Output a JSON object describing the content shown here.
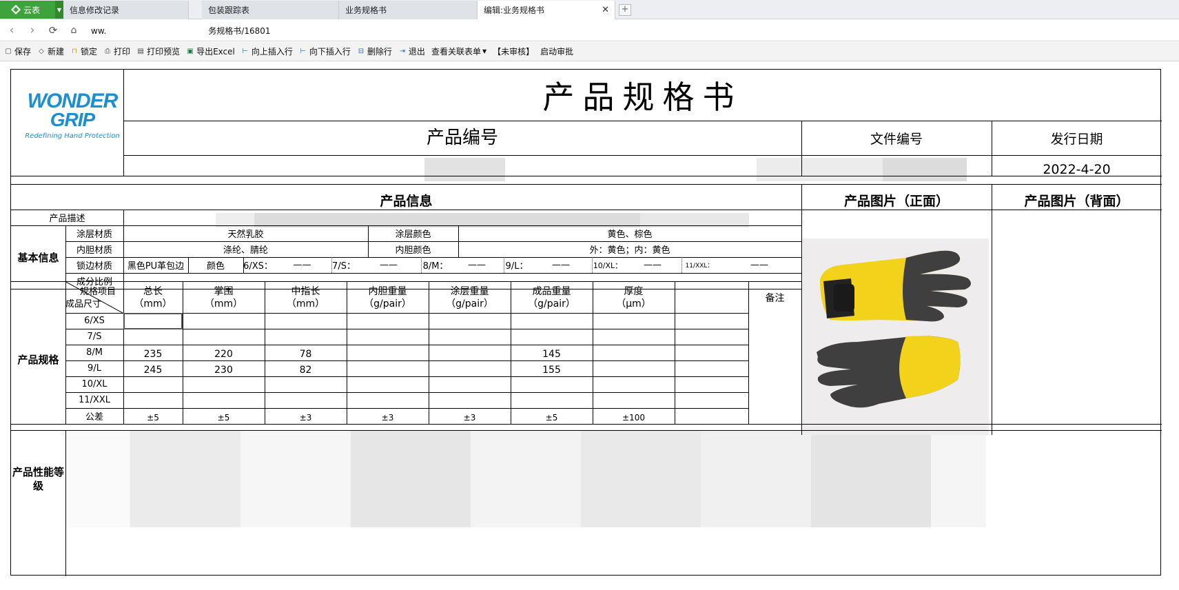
{
  "tabs": {
    "app_label": "云表",
    "items": [
      {
        "label": "信息修改记录"
      },
      {
        "label": "包装跟踪表"
      },
      {
        "label": "业务规格书"
      },
      {
        "label": "编辑:业务规格书"
      }
    ],
    "close_icon": "close-icon",
    "new_tab_icon": "new-tab-icon"
  },
  "address": {
    "prefix": "ww.",
    "suffix": "务规格书/16801"
  },
  "toolbar": [
    {
      "label": "保存",
      "icon": "save-icon"
    },
    {
      "label": "新建",
      "icon": "new-icon"
    },
    {
      "label": "锁定",
      "icon": "lock-icon"
    },
    {
      "label": "打印",
      "icon": "print-icon"
    },
    {
      "label": "打印预览",
      "icon": "print-preview-icon"
    },
    {
      "label": "导出Excel",
      "icon": "excel-icon"
    },
    {
      "label": "向上插入行",
      "icon": "insert-above-icon"
    },
    {
      "label": "向下插入行",
      "icon": "insert-below-icon"
    },
    {
      "label": "删除行",
      "icon": "delete-row-icon"
    },
    {
      "label": "退出",
      "icon": "exit-icon"
    },
    {
      "label": "查看关联表单",
      "icon": "dropdown-icon"
    },
    {
      "label": "【未审核】",
      "icon": ""
    },
    {
      "label": "启动审批",
      "icon": ""
    }
  ],
  "logo": {
    "line1": "WONDER",
    "line2": "GRIP",
    "tagline": "Redefining Hand Protection"
  },
  "doc": {
    "title": "产品规格书",
    "product_code_label": "产品编号",
    "file_no_label": "文件编号",
    "issue_date_label": "发行日期",
    "issue_date": "2022-4-20",
    "product_info": "产品信息",
    "photo_front": "产品图片（正面）",
    "photo_back": "产品图片（背面）",
    "description_label": "产品描述",
    "basic_info": "基本信息",
    "coating_material_label": "涂层材质",
    "coating_material": "天然乳胶",
    "coating_color_label": "涂层颜色",
    "coating_color": "黄色、棕色",
    "liner_material_label": "内胆材质",
    "liner_material": "涤纶、腈纶",
    "liner_color_label": "内胆颜色",
    "liner_color": "外：黄色；内：黄色",
    "edge_material_label": "锁边材质",
    "edge_material": "黑色PU革包边",
    "color_label": "颜色",
    "size_colors": [
      {
        "size": "6/XS：",
        "value": "——"
      },
      {
        "size": "7/S：",
        "value": "——"
      },
      {
        "size": "8/M：",
        "value": "——"
      },
      {
        "size": "9/L：",
        "value": "——"
      },
      {
        "size": "10/XL：",
        "value": "——"
      },
      {
        "size": "11/XXL：",
        "value": "——"
      }
    ],
    "composition_label": "成分比例",
    "spec_label": "产品规格",
    "spec_item": "规格项目",
    "finished_size": "成品尺寸",
    "remark": "备注",
    "columns": [
      {
        "name": "总长",
        "unit": "（mm）"
      },
      {
        "name": "掌围",
        "unit": "（mm）"
      },
      {
        "name": "中指长",
        "unit": "（mm）"
      },
      {
        "name": "内胆重量",
        "unit": "（g/pair）"
      },
      {
        "name": "涂层重量",
        "unit": "（g/pair）"
      },
      {
        "name": "成品重量",
        "unit": "（g/pair）"
      },
      {
        "name": "厚度",
        "unit": "（μm）"
      }
    ],
    "rows": [
      {
        "size": "6/XS",
        "cells": [
          "",
          "",
          "",
          "",
          "",
          "",
          ""
        ]
      },
      {
        "size": "7/S",
        "cells": [
          "",
          "",
          "",
          "",
          "",
          "",
          ""
        ]
      },
      {
        "size": "8/M",
        "cells": [
          "235",
          "220",
          "78",
          "",
          "",
          "145",
          ""
        ]
      },
      {
        "size": "9/L",
        "cells": [
          "245",
          "230",
          "82",
          "",
          "",
          "155",
          ""
        ]
      },
      {
        "size": "10/XL",
        "cells": [
          "",
          "",
          "",
          "",
          "",
          "",
          ""
        ]
      },
      {
        "size": "11/XXL",
        "cells": [
          "",
          "",
          "",
          "",
          "",
          "",
          ""
        ]
      },
      {
        "size": "公差",
        "cells": [
          "±5",
          "±5",
          "±3",
          "±3",
          "±3",
          "±5",
          "±100"
        ]
      }
    ],
    "performance_label": "产品性能等级"
  }
}
